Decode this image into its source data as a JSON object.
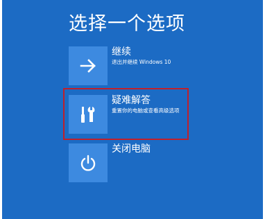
{
  "screen": {
    "title": "选择一个选项",
    "background_color": "#1c6bc4",
    "tile_color": "#3d8ae0",
    "highlight_color": "#c0202a"
  },
  "options": [
    {
      "icon": "arrow-right-icon",
      "title": "继续",
      "subtitle": "退出并继续 Windows 10"
    },
    {
      "icon": "tools-icon",
      "title": "疑难解答",
      "subtitle": "重置你的电脑或查看高级选项",
      "highlighted": true
    },
    {
      "icon": "power-icon",
      "title": "关闭电脑",
      "subtitle": ""
    }
  ]
}
